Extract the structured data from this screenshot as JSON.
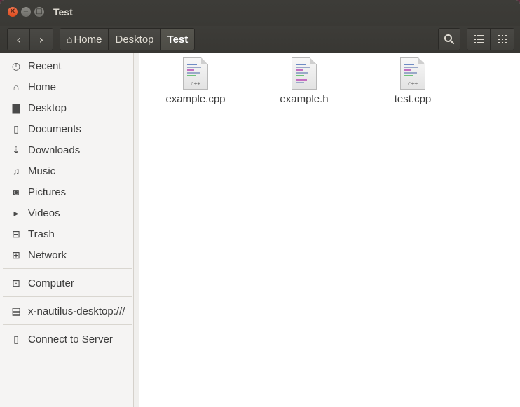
{
  "window": {
    "title": "Test"
  },
  "toolbar": {
    "breadcrumbs": [
      "Home",
      "Desktop",
      "Test"
    ]
  },
  "sidebar": {
    "items": [
      {
        "label": "Recent",
        "icon": "clock-icon"
      },
      {
        "label": "Home",
        "icon": "home-icon"
      },
      {
        "label": "Desktop",
        "icon": "folder-icon"
      },
      {
        "label": "Documents",
        "icon": "document-icon"
      },
      {
        "label": "Downloads",
        "icon": "download-icon"
      },
      {
        "label": "Music",
        "icon": "music-icon"
      },
      {
        "label": "Pictures",
        "icon": "camera-icon"
      },
      {
        "label": "Videos",
        "icon": "video-icon"
      },
      {
        "label": "Trash",
        "icon": "trash-icon"
      },
      {
        "label": "Network",
        "icon": "network-icon"
      },
      {
        "label": "Computer",
        "icon": "computer-icon"
      },
      {
        "label": "x-nautilus-desktop:///",
        "icon": "desktop-icon"
      },
      {
        "label": "Connect to Server",
        "icon": "server-icon"
      }
    ]
  },
  "files": [
    {
      "name": "example.cpp",
      "tag": "c++"
    },
    {
      "name": "example.h",
      "tag": ""
    },
    {
      "name": "test.cpp",
      "tag": "c++"
    }
  ],
  "colors": {
    "accent_close": "#de4b1d",
    "toolbar": "#3c3b37"
  }
}
